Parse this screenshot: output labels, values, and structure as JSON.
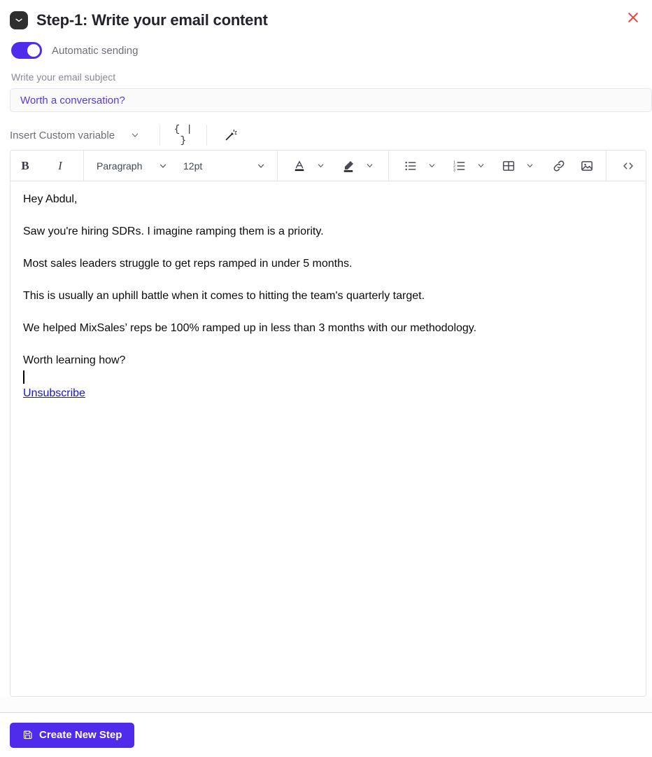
{
  "header": {
    "title": "Step-1:  Write your email content",
    "mail_icon": "envelope-icon",
    "close_icon": "close-icon",
    "close_color": "#e8453c"
  },
  "automatic_sending": {
    "label": "Automatic sending",
    "enabled": true,
    "accent_color": "#4f2beb"
  },
  "subject": {
    "label": "Write your email subject",
    "value": "Worth a conversation?",
    "placeholder": "Write your email subject",
    "text_color": "#5a36ef"
  },
  "variable_bar": {
    "insert_variable_label": "Insert Custom variable",
    "chevron_icon": "chevron-down-icon",
    "curly_variable_icon": "{ | }",
    "magic_wand_icon": "magic-wand-icon"
  },
  "toolbar": {
    "bold": "B",
    "italic": "I",
    "block_format": "Paragraph",
    "font_size": "12pt",
    "text_color_icon": "font-color-icon",
    "highlight_icon": "highlight-color-icon",
    "bullet_list_icon": "bullet-list-icon",
    "numbered_list_icon": "numbered-list-icon",
    "table_icon": "table-icon",
    "link_icon": "link-icon",
    "image_icon": "image-icon",
    "source_code_icon": "code-icon",
    "undo_icon": "undo-icon"
  },
  "email_body": {
    "paragraphs": [
      "Hey Abdul,",
      "Saw you're hiring SDRs. I imagine ramping them is a priority.",
      "Most sales leaders struggle to get reps ramped in under 5 months.",
      "This is usually an uphill battle when it comes to hitting the team's quarterly target.",
      "We helped MixSales’ reps be 100% ramped up in less than 3 months with our methodology.",
      "Worth learning how?"
    ],
    "unsubscribe_link": "Unsubscribe",
    "link_color": "#1414e0"
  },
  "footer": {
    "create_step_label": "Create New Step",
    "save_icon": "save-icon",
    "button_color": "#4f2beb"
  }
}
